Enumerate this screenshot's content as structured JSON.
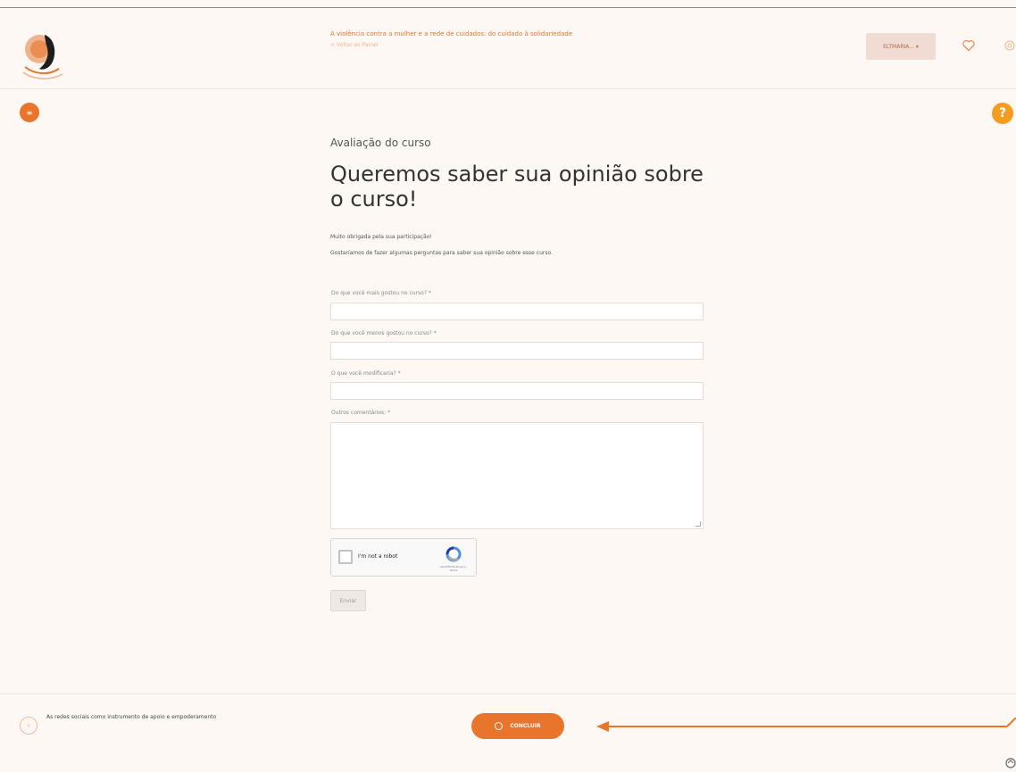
{
  "header": {
    "course_title": "A violência contra a mulher e a rede de cuidados: do cuidado à solidariedade",
    "course_subtitle": "< Voltar ao Painel",
    "user_menu_label": "ELTMARIA... ▾"
  },
  "page": {
    "eyebrow": "Avaliação do curso",
    "headline": "Queremos saber sua opinião sobre o curso!",
    "intro_line1": "Muito obrigada pela sua participação!",
    "intro_line2": "Gostaríamos de fazer algumas perguntas para saber sua opinião sobre esse curso."
  },
  "form": {
    "q1_label": "Do que você mais gostou no curso? *",
    "q2_label": "Do que você menos gostou no curso? *",
    "q3_label": "O que você modificaria? *",
    "q4_label": "Outros comentários: *",
    "q1_value": "",
    "q2_value": "",
    "q3_value": "",
    "q4_value": "",
    "captcha_label": "I'm not a robot",
    "captcha_brand": "reCAPTCHA Privacy - Terms",
    "submit_label": "Enviar"
  },
  "footer": {
    "prev_lesson_label": "As redes sociais como instrumento de apoio e empoderamento",
    "finish_label": "CONCLUIR"
  },
  "colors": {
    "accent": "#e9742b",
    "help": "#f39c1e",
    "background": "#fdf8f4"
  },
  "icons": {
    "menu": "menu-icon",
    "help": "question-icon",
    "favorite": "heart-icon",
    "settings": "gear-icon",
    "previous": "chevron-left-icon",
    "finish": "circle-icon",
    "arrow": "arrow-left-icon",
    "corner": "accessibility-icon"
  }
}
